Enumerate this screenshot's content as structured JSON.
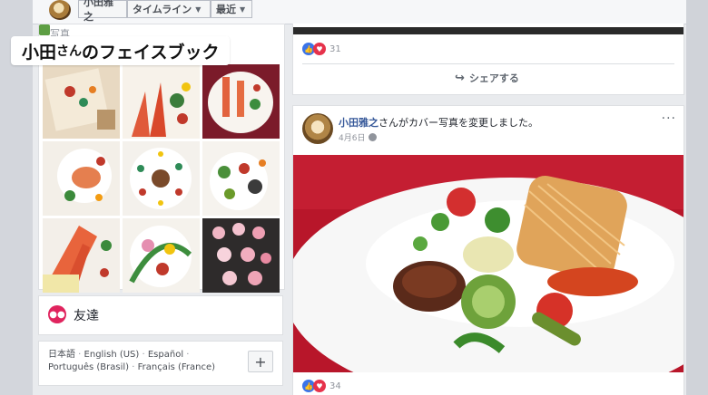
{
  "header": {
    "name_label": "小田雅之",
    "timeline_label": "タイムライン",
    "recent_label": "最近"
  },
  "caption": {
    "part1": "小田",
    "part2": "さん",
    "part3": "のフェイスブック"
  },
  "photos": {
    "title": "写真"
  },
  "friends": {
    "label": "友達"
  },
  "languages": {
    "items": [
      "日本語",
      "English (US)",
      "Español",
      "Português (Brasil)",
      "Français (France)"
    ],
    "add_label": "+"
  },
  "post1": {
    "reaction_count": "31",
    "share_label": "シェアする"
  },
  "post2": {
    "author": "小田雅之",
    "action_text": "さんがカバー写真を変更しました。",
    "date": "4月6日",
    "more_label": "···",
    "reaction_count": "34"
  },
  "colors": {
    "accent": "#365899",
    "like_blue": "#3b74e8",
    "love_red": "#e6324b"
  }
}
